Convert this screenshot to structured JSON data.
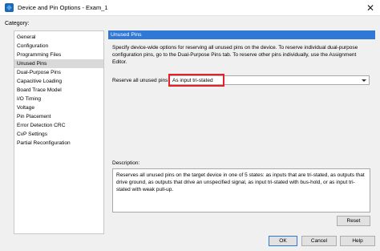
{
  "window": {
    "title": "Device and Pin Options - Exam_1",
    "close_glyph": "✕"
  },
  "sidebar": {
    "label": "Category:",
    "items": [
      {
        "label": "General"
      },
      {
        "label": "Configuration"
      },
      {
        "label": "Programming Files"
      },
      {
        "label": "Unused Pins"
      },
      {
        "label": "Dual-Purpose Pins"
      },
      {
        "label": "Capacitive Loading"
      },
      {
        "label": "Board Trace Model"
      },
      {
        "label": "I/O Timing"
      },
      {
        "label": "Voltage"
      },
      {
        "label": "Pin Placement"
      },
      {
        "label": "Error Detection CRC"
      },
      {
        "label": "CvP Settings"
      },
      {
        "label": "Partial Reconfiguration"
      }
    ],
    "selected": "Unused Pins"
  },
  "panel": {
    "header": "Unused Pins",
    "description": "Specify device-wide options for reserving all unused pins on the device. To reserve individual dual-purpose configuration pins, go to the Dual-Purpose Pins tab. To reserve other pins individually, use the Assignment Editor.",
    "reserve_label": "Reserve all unused pins:",
    "reserve_value": "As input tri-stated",
    "description_label": "Description:",
    "description_text": "Reserves all unused pins on the target device in one of 5 states: as inputs that are tri-stated, as outputs that drive ground, as outputs that drive an unspecified signal, as input tri-stated with bus-hold, or as input tri-stated with weak pull-up.",
    "reset_label": "Reset"
  },
  "buttons": {
    "ok": "OK",
    "cancel": "Cancel",
    "help": "Help"
  },
  "colors": {
    "header_bg": "#3178d6",
    "highlight": "#e4202a"
  }
}
